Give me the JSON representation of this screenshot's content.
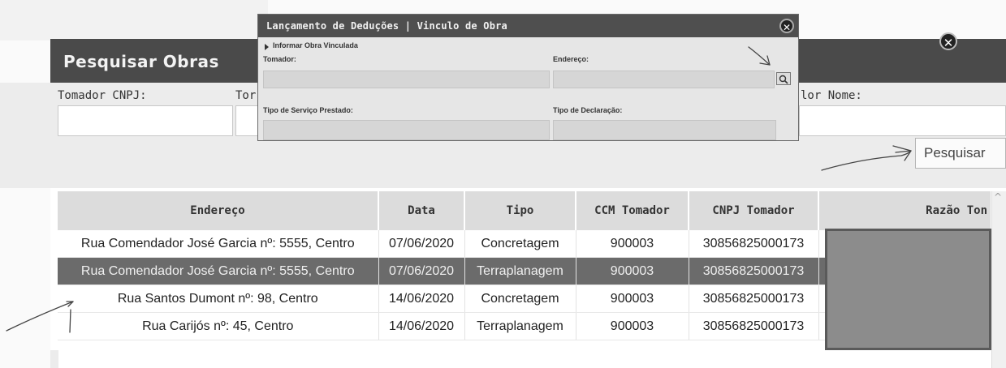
{
  "popup": {
    "title": "Lançamento de Deduções | Vinculo de Obra",
    "section": "Informar Obra Vinculada",
    "tomador_label": "Tomador:",
    "endereco_label": "Endereço:",
    "tipo_servico_label": "Tipo de Serviço Prestado:",
    "tipo_declaracao_label": "Tipo de Declaração:"
  },
  "dialog": {
    "title": "Pesquisar Obras",
    "tomador_cnpj_label": "Tomador CNPJ:",
    "tomador_ccm_label_partial": "Tor",
    "tomador_nome_label_partial": "lor Nome:",
    "search_button": "Pesquisar"
  },
  "table": {
    "headers": [
      "Endereço",
      "Data",
      "Tipo",
      "CCM Tomador",
      "CNPJ Tomador",
      "Razão Ton"
    ],
    "rows": [
      {
        "endereco": "Rua Comendador José Garcia nº: 5555, Centro",
        "data": "07/06/2020",
        "tipo": "Concretagem",
        "ccm": "900003",
        "cnpj": "30856825000173"
      },
      {
        "endereco": "Rua Comendador José Garcia nº: 5555, Centro",
        "data": "07/06/2020",
        "tipo": "Terraplanagem",
        "ccm": "900003",
        "cnpj": "30856825000173"
      },
      {
        "endereco": "Rua Santos Dumont nº: 98, Centro",
        "data": "14/06/2020",
        "tipo": "Concretagem",
        "ccm": "900003",
        "cnpj": "30856825000173"
      },
      {
        "endereco": "Rua Carijós nº: 45, Centro",
        "data": "14/06/2020",
        "tipo": "Terraplanagem",
        "ccm": "900003",
        "cnpj": "30856825000173"
      }
    ]
  },
  "icons": {
    "close": "close-icon",
    "search": "magnifier-icon",
    "expand": "triangle-right-icon",
    "scroll_up": "chevron-up-icon"
  },
  "colors": {
    "header_bg": "#4a4a4a",
    "selected_row": "#6b6b6b",
    "table_header": "#dcdcdc"
  }
}
